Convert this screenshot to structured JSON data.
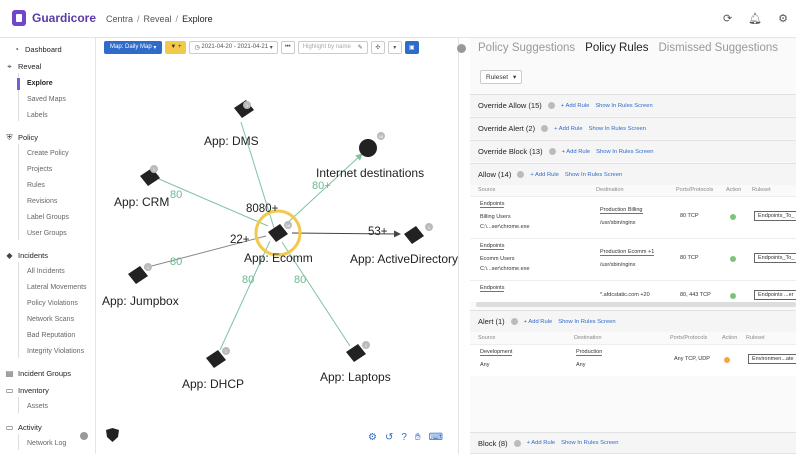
{
  "app": {
    "name": "Guardicore"
  },
  "breadcrumb": [
    "Centra",
    "Reveal",
    "Explore"
  ],
  "top_icons": [
    "refresh-icon",
    "bell-icon",
    "settings-icon"
  ],
  "sidebar": {
    "dashboard": "Dashboard",
    "reveal": {
      "label": "Reveal",
      "items": [
        "Explore",
        "Saved Maps",
        "Labels"
      ]
    },
    "policy": {
      "label": "Policy",
      "items": [
        "Create Policy",
        "Projects",
        "Rules",
        "Revisions",
        "Label Groups",
        "User Groups"
      ]
    },
    "incidents": {
      "label": "Incidents",
      "items": [
        "All Incidents",
        "Lateral Movements",
        "Policy Violations",
        "Network Scans",
        "Bad Reputation",
        "Integrity Violations"
      ]
    },
    "incident_groups": "Incident Groups",
    "inventory": {
      "label": "Inventory",
      "items": [
        "Assets"
      ]
    },
    "activity": {
      "label": "Activity",
      "items": [
        "Network Log"
      ]
    }
  },
  "map_toolbar": {
    "map_button": "Map: Daily Map",
    "filter_button": "▼ +",
    "date_range": "2021-04-20 - 2021-04-21",
    "search_placeholder": "Highlight by name"
  },
  "map": {
    "nodes": {
      "dms": "App: DMS",
      "crm": "App: CRM",
      "internet": "Internet destinations",
      "ecomm": "App: Ecomm",
      "jumpbox": "App: Jumpbox",
      "active_directory": "App: ActiveDirectory",
      "dhcp": "App: DHCP",
      "laptops": "App: Laptops"
    },
    "counts": {
      "ecomm_top": "8080+",
      "ecomm_left": "22+",
      "to_ad": "53+"
    },
    "edge_labels": {
      "crm": "80",
      "internet": "80+",
      "jumpbox": "80",
      "dhcp": "80",
      "laptops": "80"
    },
    "badges": {
      "dms": "1",
      "crm": "1",
      "internet": "18",
      "ecomm": "18",
      "jumpbox": "1",
      "active_directory": "1",
      "dhcp": "1",
      "laptops": "1"
    }
  },
  "right_panel": {
    "tabs": [
      "Policy Suggestions",
      "Policy Rules",
      "Dismissed Suggestions"
    ],
    "ruleset_button": "Ruleset",
    "add_rule": "+ Add Rule",
    "show_in_rules": "Show In Rules Screen",
    "groups": {
      "override_allow": "Override Allow (15)",
      "override_alert": "Override Alert (2)",
      "override_block": "Override Block (13)",
      "allow": "Allow (14)",
      "alert": "Alert (1)",
      "block": "Block (8)"
    },
    "columns": {
      "source": "Source",
      "destination": "Destination",
      "ports": "Ports/Protocols",
      "action": "Action",
      "ruleset": "Ruleset"
    },
    "allow_rows": [
      {
        "src_label": "Endpoints",
        "src_user": "Billing Users",
        "src_proc": "C:\\...ser\\chrome.exe",
        "dst_label": "Production Billing",
        "dst_proc": "/usr/sbin/nginx",
        "ports": "80  TCP",
        "ruleset": "Endpoints_To_"
      },
      {
        "src_label": "Endpoints",
        "src_user": "Ecomm Users",
        "src_proc": "C:\\...ser\\chrome.exe",
        "dst_label": "Production Ecomm +1",
        "dst_proc": "/usr/sbin/nginx",
        "ports": "80  TCP",
        "ruleset": "Endpoints_To_"
      },
      {
        "src_label": "Endpoints",
        "src_user": "",
        "src_proc": "",
        "dst_label": "*.afdcstatic.com +20",
        "dst_proc": "",
        "ports": "80, 443  TCP",
        "ruleset": "Endpoints ...er"
      }
    ],
    "alert_rows": [
      {
        "src_label": "Development",
        "src_sub": "Any",
        "dst_label": "Production",
        "dst_sub": "Any",
        "ports": "Any  TCP, UDP",
        "ruleset": "Environmen...ate"
      }
    ]
  },
  "colors": {
    "accent": "#2f6bc8",
    "brand": "#5b3aa8",
    "edge": "#7fc3a0",
    "ecomm_ring": "#f2c94c"
  }
}
